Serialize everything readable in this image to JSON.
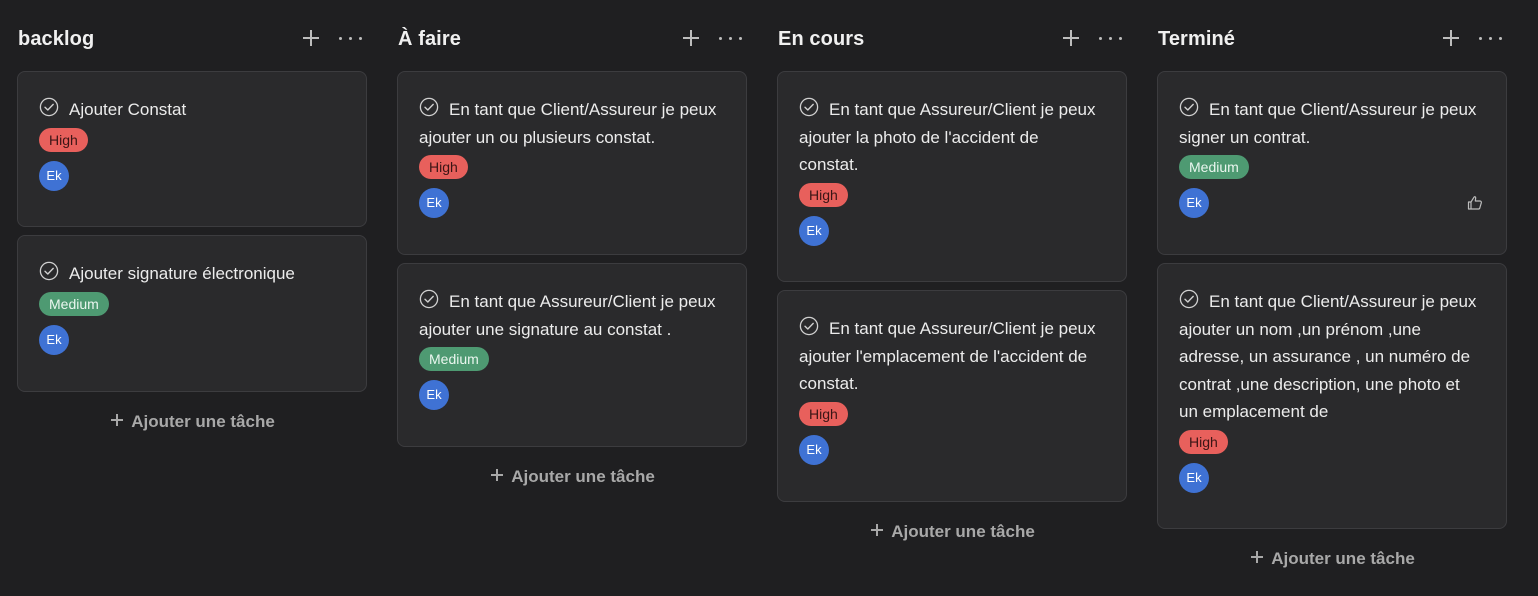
{
  "board": {
    "columns": [
      {
        "title": "backlog",
        "add_task_label": "Ajouter une tâche",
        "cards": [
          {
            "title": "Ajouter Constat",
            "priority": "High",
            "assignee": "Ek",
            "liked": false
          },
          {
            "title": "Ajouter signature électronique",
            "priority": "Medium",
            "assignee": "Ek",
            "liked": false
          }
        ]
      },
      {
        "title": "À faire",
        "add_task_label": "Ajouter une tâche",
        "cards": [
          {
            "title": "En tant que Client/Assureur je peux ajouter un ou plusieurs constat.",
            "priority": "High",
            "assignee": "Ek",
            "liked": false
          },
          {
            "title": "En tant que Assureur/Client je peux ajouter une signature au constat .",
            "priority": "Medium",
            "assignee": "Ek",
            "liked": false
          }
        ]
      },
      {
        "title": "En cours",
        "add_task_label": "Ajouter une tâche",
        "cards": [
          {
            "title": "En tant que Assureur/Client je peux ajouter la photo de l'accident de constat.",
            "priority": "High",
            "assignee": "Ek",
            "liked": false
          },
          {
            "title": "En tant que Assureur/Client je peux ajouter l'emplacement de l'accident de constat.",
            "priority": "High",
            "assignee": "Ek",
            "liked": false
          }
        ]
      },
      {
        "title": "Terminé",
        "add_task_label": "Ajouter une tâche",
        "cards": [
          {
            "title": "En tant que Client/Assureur je peux signer un contrat.",
            "priority": "Medium",
            "assignee": "Ek",
            "liked": true
          },
          {
            "title": "En tant que Client/Assureur je peux ajouter un nom ,un prénom ,une adresse, un assurance , un numéro de contrat ,une description, une photo et un emplacement de",
            "priority": "High",
            "assignee": "Ek",
            "liked": false
          }
        ]
      }
    ]
  },
  "colors": {
    "background": "#1f1f21",
    "card": "#2a2a2c",
    "high": "#e8605c",
    "medium": "#4e9a72",
    "avatar": "#3f72d4"
  },
  "icons": {
    "check": "check-circle-icon",
    "add": "plus-icon",
    "more": "more-horizontal-icon",
    "like": "thumbs-up-icon"
  }
}
